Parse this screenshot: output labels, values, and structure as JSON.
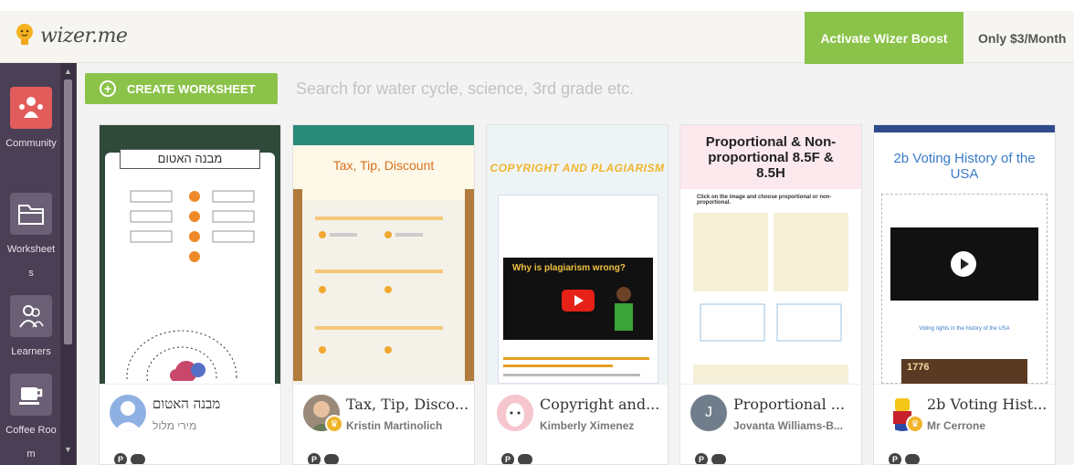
{
  "header": {
    "logo_text": "wizer.me",
    "boost_button": "Activate Wizer Boost",
    "price_text": "Only $3/Month"
  },
  "sidebar": {
    "items": [
      {
        "label": "Community",
        "icon": "community-icon"
      },
      {
        "label": "Worksheets",
        "icon": "folder-icon"
      },
      {
        "label": "Learners",
        "icon": "learners-icon"
      },
      {
        "label": "Coffee Room",
        "icon": "coffee-icon"
      }
    ]
  },
  "toolbar": {
    "create_label": "CREATE WORKSHEET",
    "search_placeholder": "Search for water cycle, science, 3rd grade etc."
  },
  "cards": [
    {
      "thumb_title": "מבנה האטום",
      "title": "מבנה האטום",
      "author": "מירי מלול",
      "avatar": "default-avatar",
      "boost": false
    },
    {
      "thumb_title": "Tax, Tip, Discount",
      "title": "Tax, Tip, Disco...",
      "author": "Kristin Martinolich",
      "avatar": "photo-avatar",
      "boost": true
    },
    {
      "thumb_title": "COPYRIGHT AND PLAGIARISM",
      "thumb_subtitle": "Why is plagiarism wrong?",
      "title": "Copyright and...",
      "author": "Kimberly Ximenez",
      "avatar": "llama-avatar",
      "boost": false
    },
    {
      "thumb_title": "Proportional & Non-proportional 8.5F & 8.5H",
      "thumb_subtitle": "Click on the image and choose proportional or non-proportional.",
      "title": "Proportional ...",
      "author": "Jovanta Williams-B...",
      "avatar_letter": "J",
      "boost": false
    },
    {
      "thumb_title": "2b Voting History of the USA",
      "thumb_subtitle": "Voting rights in the history of the USA",
      "thumb_year": "1776",
      "title": "2b Voting Hist...",
      "author": "Mr Cerrone",
      "avatar": "lego-avatar",
      "boost": true
    }
  ],
  "colors": {
    "brand_green": "#8bc34a",
    "sidebar_bg": "#4a3f54",
    "active_item": "#e25c5c"
  }
}
